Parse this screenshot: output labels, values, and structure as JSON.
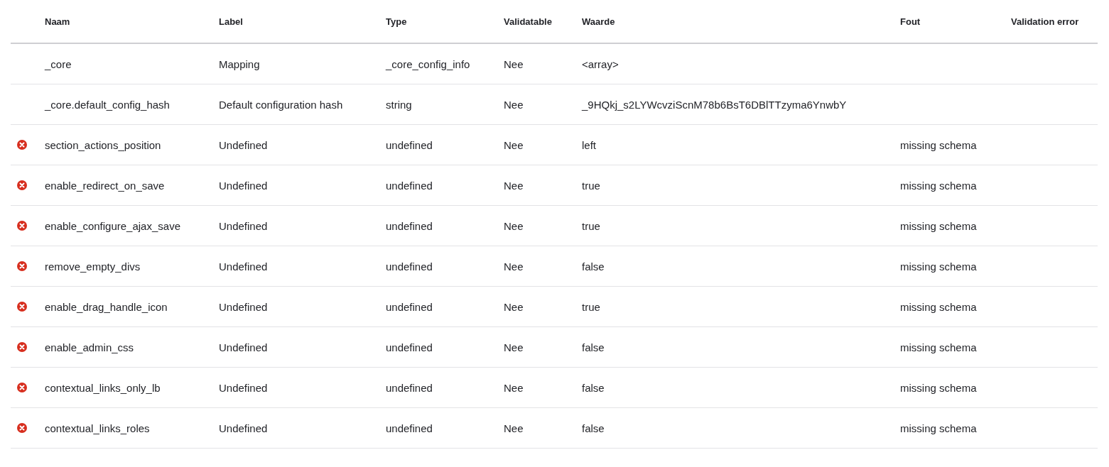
{
  "table": {
    "columns": [
      "Naam",
      "Label",
      "Type",
      "Validatable",
      "Waarde",
      "Fout",
      "Validation error"
    ],
    "rows": [
      {
        "error": false,
        "cells": [
          "_core",
          "Mapping",
          "_core_config_info",
          "Nee",
          "<array>",
          "",
          ""
        ]
      },
      {
        "error": false,
        "cells": [
          "_core.default_config_hash",
          "Default configuration hash",
          "string",
          "Nee",
          "_9HQkj_s2LYWcvziScnM78b6BsT6DBlTTzyma6YnwbY",
          "",
          ""
        ]
      },
      {
        "error": true,
        "cells": [
          "section_actions_position",
          "Undefined",
          "undefined",
          "Nee",
          "left",
          "missing schema",
          ""
        ]
      },
      {
        "error": true,
        "cells": [
          "enable_redirect_on_save",
          "Undefined",
          "undefined",
          "Nee",
          "true",
          "missing schema",
          ""
        ]
      },
      {
        "error": true,
        "cells": [
          "enable_configure_ajax_save",
          "Undefined",
          "undefined",
          "Nee",
          "true",
          "missing schema",
          ""
        ]
      },
      {
        "error": true,
        "cells": [
          "remove_empty_divs",
          "Undefined",
          "undefined",
          "Nee",
          "false",
          "missing schema",
          ""
        ]
      },
      {
        "error": true,
        "cells": [
          "enable_drag_handle_icon",
          "Undefined",
          "undefined",
          "Nee",
          "true",
          "missing schema",
          ""
        ]
      },
      {
        "error": true,
        "cells": [
          "enable_admin_css",
          "Undefined",
          "undefined",
          "Nee",
          "false",
          "missing schema",
          ""
        ]
      },
      {
        "error": true,
        "cells": [
          "contextual_links_only_lb",
          "Undefined",
          "undefined",
          "Nee",
          "false",
          "missing schema",
          ""
        ]
      },
      {
        "error": true,
        "cells": [
          "contextual_links_roles",
          "Undefined",
          "undefined",
          "Nee",
          "false",
          "missing schema",
          ""
        ]
      }
    ]
  }
}
